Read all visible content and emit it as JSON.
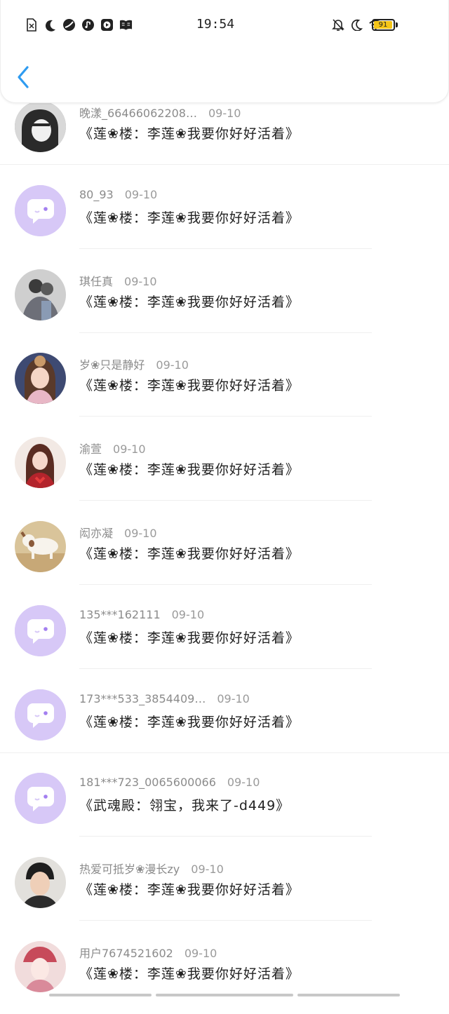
{
  "status_bar": {
    "time": "19:54",
    "battery": "91",
    "left_icons": [
      "sim-off-icon",
      "moon-icon",
      "leaf-icon",
      "music-icon",
      "play-icon",
      "book-icon"
    ],
    "right_icons": [
      "bell-off-icon",
      "moon-icon",
      "wifi-icon"
    ],
    "accent": "#f5c518"
  },
  "header": {
    "back_icon": "chevron-left-icon",
    "accent": "#2e9bf0"
  },
  "comments": [
    {
      "user": "晚漾_66466062208…",
      "date": "09-10",
      "text": "《莲❀楼：李莲❀我要你好好活着》",
      "avatar": "photo-bw"
    },
    {
      "user": "80_93",
      "date": "09-10",
      "text": "《莲❀楼：李莲❀我要你好好活着》",
      "avatar": "default"
    },
    {
      "user": "琪任真",
      "date": "09-10",
      "text": "《莲❀楼：李莲❀我要你好好活着》",
      "avatar": "photo-couple"
    },
    {
      "user": "岁❀只是静好",
      "date": "09-10",
      "text": "《莲❀楼：李莲❀我要你好好活着》",
      "avatar": "photo-girl"
    },
    {
      "user": "渝萱",
      "date": "09-10",
      "text": "《莲❀楼：李莲❀我要你好好活着》",
      "avatar": "photo-heart"
    },
    {
      "user": "闳亦凝",
      "date": "09-10",
      "text": "《莲❀楼：李莲❀我要你好好活着》",
      "avatar": "photo-dog"
    },
    {
      "user": "135***162111",
      "date": "09-10",
      "text": "《莲❀楼：李莲❀我要你好好活着》",
      "avatar": "default"
    },
    {
      "user": "173***533_3854409…",
      "date": "09-10",
      "text": "《莲❀楼：李莲❀我要你好好活着》",
      "avatar": "default"
    },
    {
      "user": "181***723_0065600066",
      "date": "09-10",
      "text": "《武魂殿：翎宝，我来了-d449》",
      "avatar": "default"
    },
    {
      "user": "热爱可抵岁❀漫长zy",
      "date": "09-10",
      "text": "《莲❀楼：李莲❀我要你好好活着》",
      "avatar": "photo-man"
    },
    {
      "user": "用户7674521602",
      "date": "09-10",
      "text": "《莲❀楼：李莲❀我要你好好活着》",
      "avatar": "photo-opera"
    }
  ]
}
